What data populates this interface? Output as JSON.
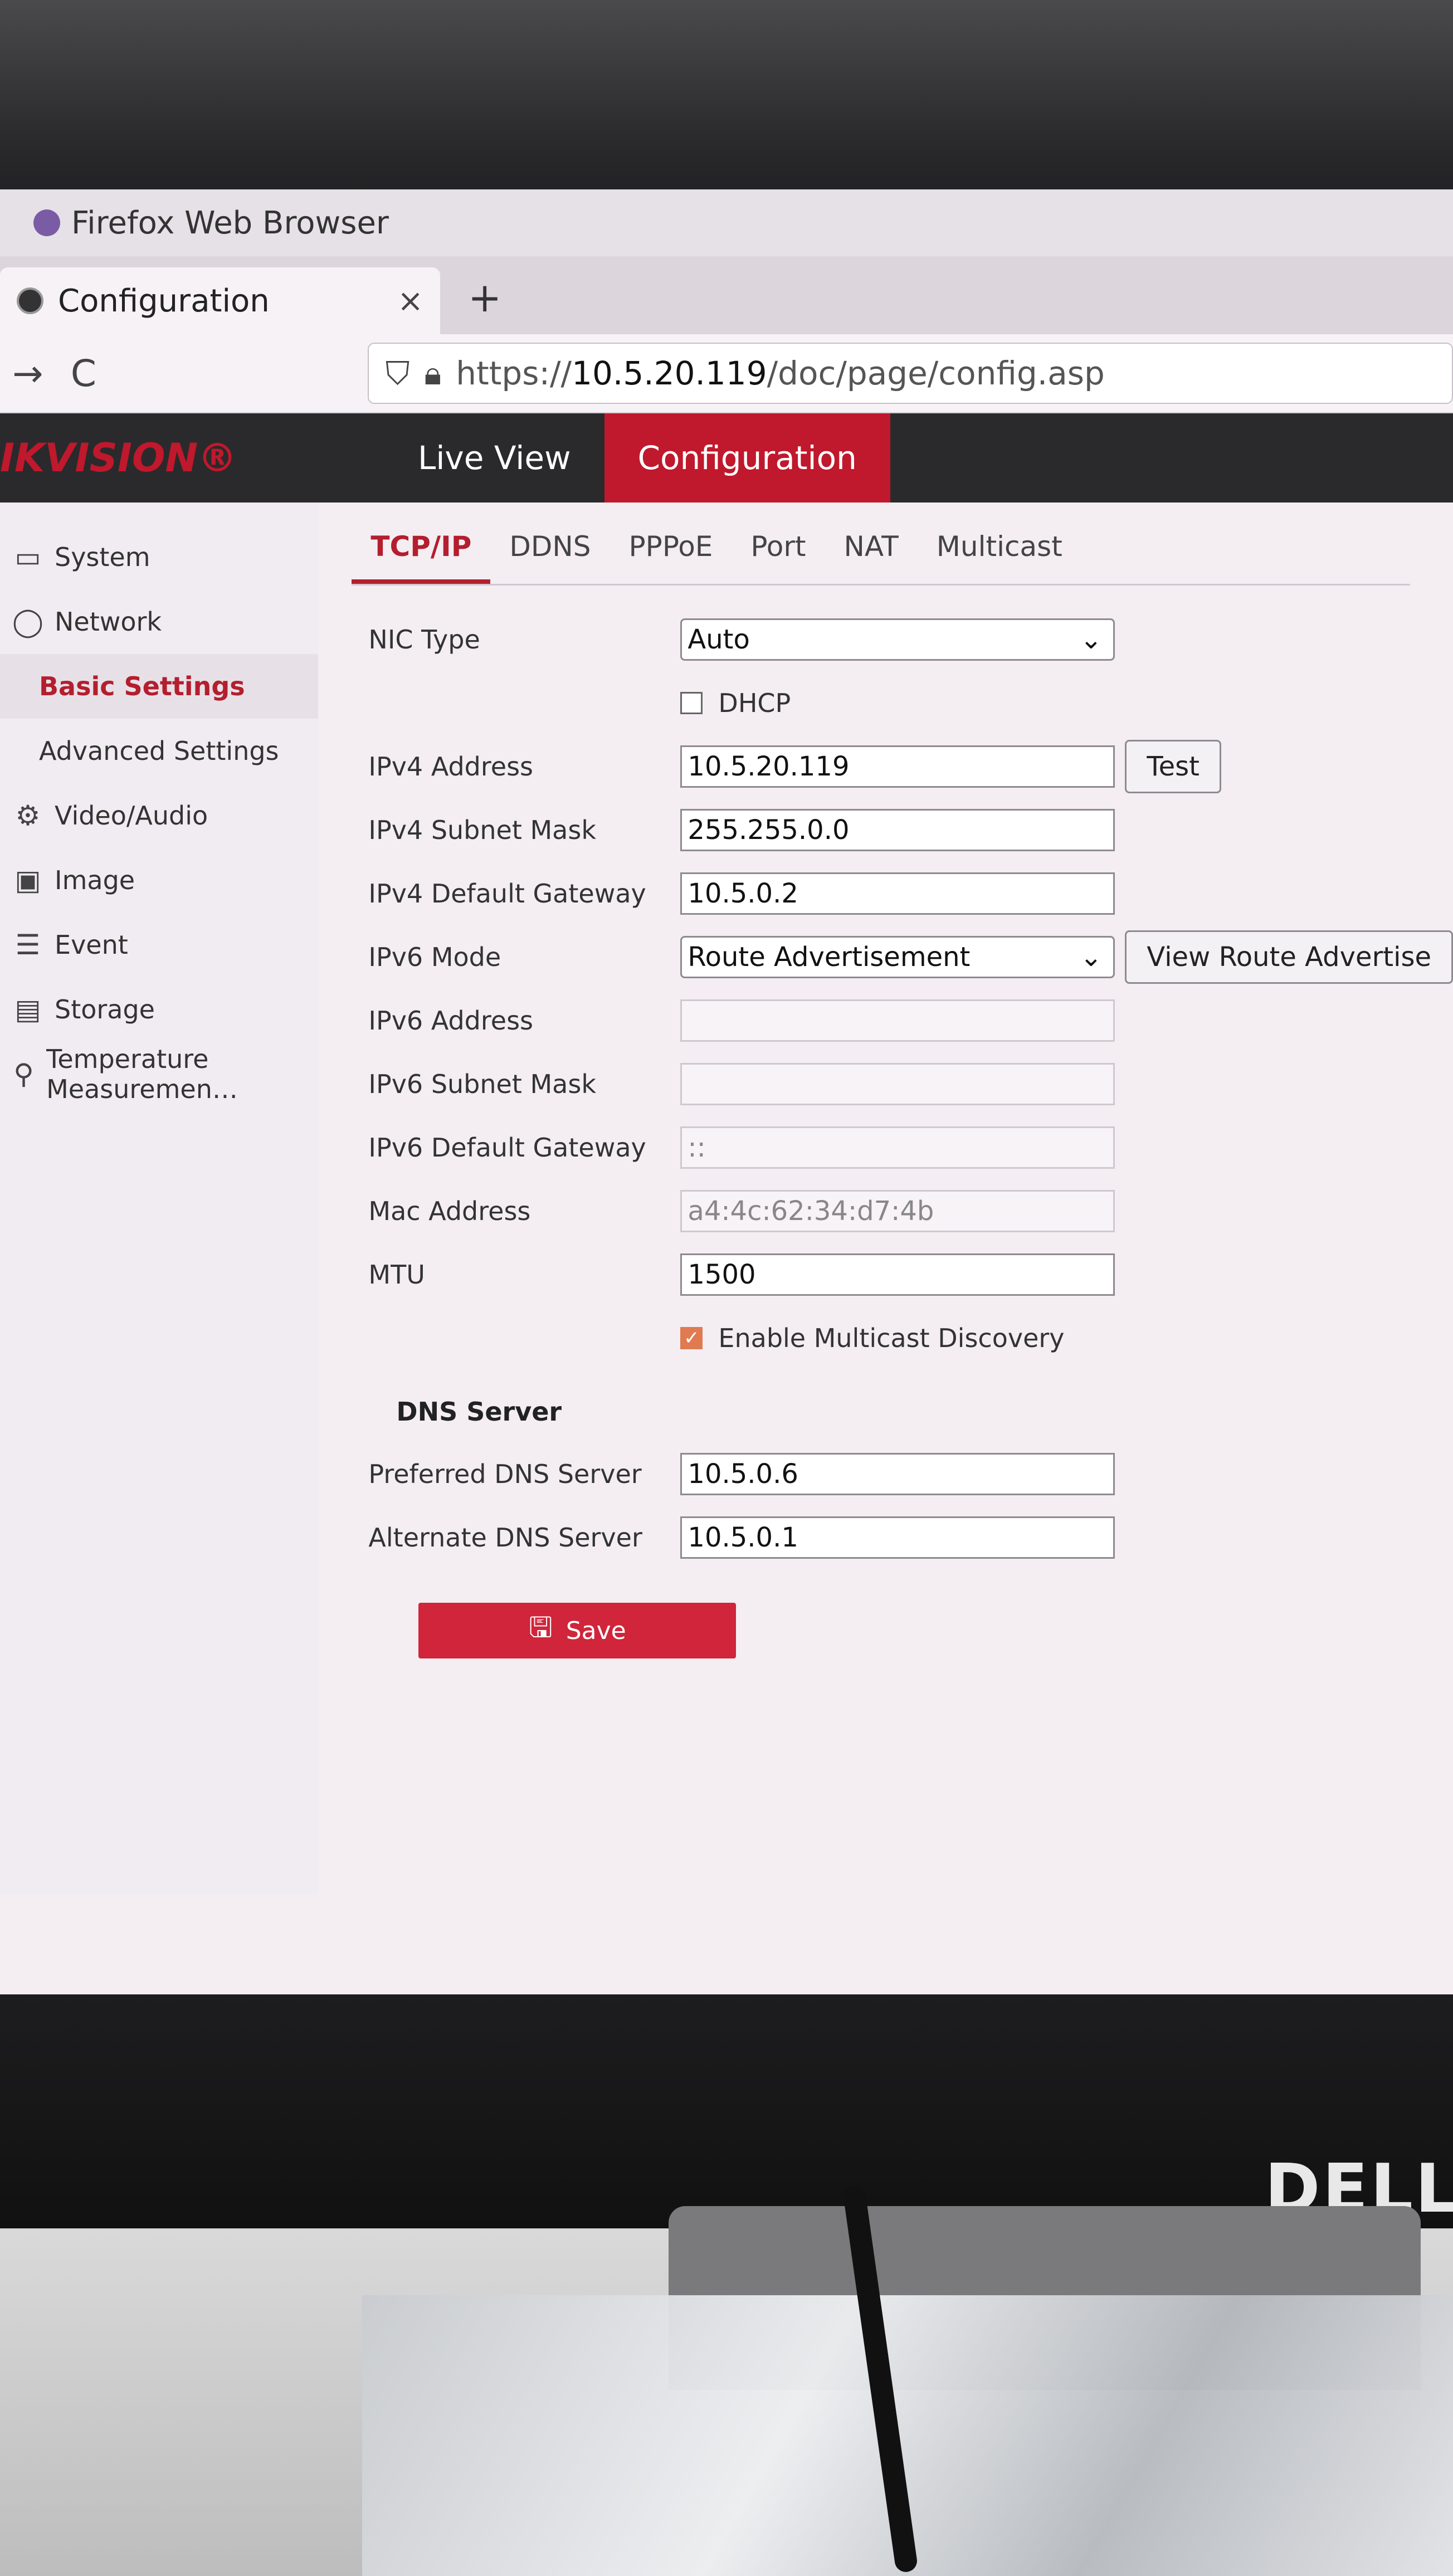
{
  "browser": {
    "title": "Firefox Web Browser",
    "tab_label": "Configuration",
    "close_glyph": "×",
    "new_tab_glyph": "+",
    "back_glyph": "→",
    "reload_glyph": "C",
    "url_scheme": "https://",
    "url_host": "10.5.20.119",
    "url_path": "/doc/page/config.asp"
  },
  "header": {
    "logo": "IKVISION®",
    "tabs": [
      {
        "label": "Live View",
        "active": false
      },
      {
        "label": "Configuration",
        "active": true
      }
    ]
  },
  "sidebar": {
    "items": [
      {
        "label": "System",
        "icon": "system-icon"
      },
      {
        "label": "Network",
        "icon": "network-icon"
      },
      {
        "label": "Basic Settings",
        "active": true
      },
      {
        "label": "Advanced Settings"
      },
      {
        "label": "Video/Audio",
        "icon": "video-icon"
      },
      {
        "label": "Image",
        "icon": "image-icon"
      },
      {
        "label": "Event",
        "icon": "event-icon"
      },
      {
        "label": "Storage",
        "icon": "storage-icon"
      },
      {
        "label": "Temperature Measuremen…",
        "icon": "thermometer-icon"
      }
    ]
  },
  "subtabs": [
    "TCP/IP",
    "DDNS",
    "PPPoE",
    "Port",
    "NAT",
    "Multicast"
  ],
  "form": {
    "nic_type_label": "NIC Type",
    "nic_type_value": "Auto",
    "dhcp_label": "DHCP",
    "dhcp_checked": false,
    "ipv4_address_label": "IPv4 Address",
    "ipv4_address": "10.5.20.119",
    "test_label": "Test",
    "ipv4_mask_label": "IPv4 Subnet Mask",
    "ipv4_mask": "255.255.0.0",
    "ipv4_gateway_label": "IPv4 Default Gateway",
    "ipv4_gateway": "10.5.0.2",
    "ipv6_mode_label": "IPv6 Mode",
    "ipv6_mode_value": "Route Advertisement",
    "view_route_label": "View Route Advertise",
    "ipv6_address_label": "IPv6 Address",
    "ipv6_address": "",
    "ipv6_mask_label": "IPv6 Subnet Mask",
    "ipv6_mask": "",
    "ipv6_gateway_label": "IPv6 Default Gateway",
    "ipv6_gateway": "::",
    "mac_label": "Mac Address",
    "mac": "a4:4c:62:34:d7:4b",
    "mtu_label": "MTU",
    "mtu": "1500",
    "multicast_label": "Enable Multicast Discovery",
    "multicast_checked": true,
    "dns_section": "DNS Server",
    "dns_pref_label": "Preferred DNS Server",
    "dns_pref": "10.5.0.6",
    "dns_alt_label": "Alternate DNS Server",
    "dns_alt": "10.5.0.1",
    "save_label": "Save"
  },
  "monitor_brand": "DELL"
}
